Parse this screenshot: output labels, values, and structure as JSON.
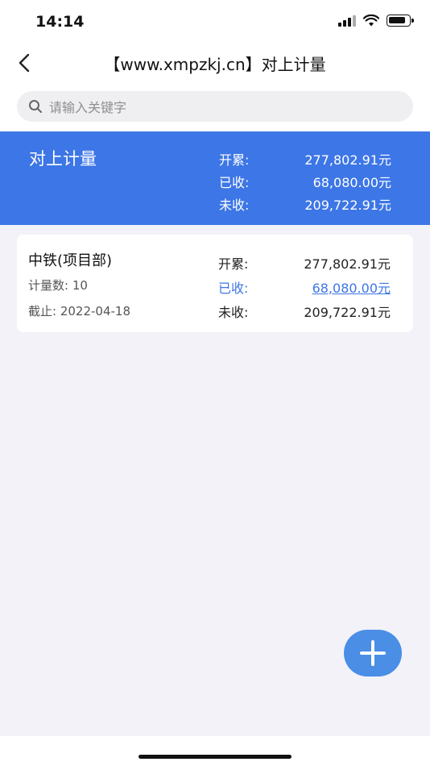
{
  "status_bar": {
    "time": "14:14"
  },
  "nav": {
    "title": "【www.xmpzkj.cn】对上计量"
  },
  "search": {
    "placeholder": "请输入关键字"
  },
  "summary": {
    "title": "对上计量",
    "rows": [
      {
        "label": "开累:",
        "value": "277,802.91元"
      },
      {
        "label": "已收:",
        "value": "68,080.00元"
      },
      {
        "label": "未收:",
        "value": "209,722.91元"
      }
    ]
  },
  "cards": [
    {
      "name": "中铁(项目部)",
      "count": "计量数: 10",
      "date": "截止: 2022-04-18",
      "rows": [
        {
          "label": "开累:",
          "value": "277,802.91元"
        },
        {
          "label": "已收:",
          "value": "68,080.00元"
        },
        {
          "label": "未收:",
          "value": "209,722.91元"
        }
      ]
    }
  ],
  "icons": {
    "back": "chevron-left-icon",
    "search": "search-icon",
    "add": "plus-icon"
  },
  "colors": {
    "accent": "#3d76e6",
    "fab": "#4a8ee6",
    "background": "#f2f2f8"
  }
}
